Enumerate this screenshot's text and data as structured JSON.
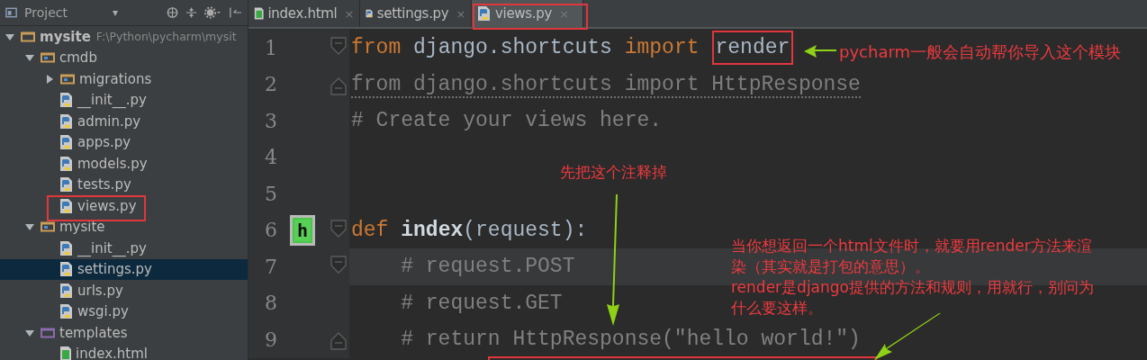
{
  "project_panel": {
    "title": "Project",
    "caret": "▾"
  },
  "tree": [
    {
      "label": "mysite",
      "path": "F:\\Python\\pycharm\\mysit",
      "kind": "project",
      "expanded": true,
      "selected": false,
      "children": [
        {
          "label": "cmdb",
          "kind": "module",
          "expanded": true,
          "selected": false,
          "children": [
            {
              "label": "migrations",
              "kind": "module",
              "expanded": false,
              "selected": false
            },
            {
              "label": "__init__.py",
              "kind": "py",
              "selected": false
            },
            {
              "label": "admin.py",
              "kind": "py",
              "selected": false
            },
            {
              "label": "apps.py",
              "kind": "py",
              "selected": false
            },
            {
              "label": "models.py",
              "kind": "py",
              "selected": false
            },
            {
              "label": "tests.py",
              "kind": "py",
              "selected": false
            },
            {
              "label": "views.py",
              "kind": "py",
              "selected": false
            }
          ]
        },
        {
          "label": "mysite",
          "kind": "module",
          "expanded": true,
          "selected": false,
          "children": [
            {
              "label": "__init__.py",
              "kind": "py",
              "selected": false
            },
            {
              "label": "settings.py",
              "kind": "py",
              "selected": true
            },
            {
              "label": "urls.py",
              "kind": "py",
              "selected": false
            },
            {
              "label": "wsgi.py",
              "kind": "py",
              "selected": false
            }
          ]
        },
        {
          "label": "templates",
          "kind": "templates",
          "expanded": true,
          "selected": false,
          "children": [
            {
              "label": "index.html",
              "kind": "html",
              "selected": false
            }
          ]
        }
      ]
    }
  ],
  "tabs": [
    {
      "label": "index.html",
      "kind": "html",
      "close": "×",
      "selected": false
    },
    {
      "label": "settings.py",
      "kind": "py",
      "close": "×",
      "selected": false
    },
    {
      "label": "views.py",
      "kind": "py",
      "close": "×",
      "selected": true
    }
  ],
  "code": [
    {
      "number": "1",
      "kind": "fold_start",
      "current": false,
      "tokens": [
        {
          "text": "from",
          "kind": "keyword"
        },
        {
          "text": " django.shortcuts ",
          "kind": "plain"
        },
        {
          "text": "import",
          "kind": "keyword"
        },
        {
          "text": "render",
          "kind": "boxed"
        }
      ]
    },
    {
      "number": "2",
      "kind": "fold_end",
      "current": false,
      "tokens": [
        {
          "text": "from django.shortcuts import HttpResponse",
          "kind": "unused"
        }
      ]
    },
    {
      "number": "3",
      "current": false,
      "tokens": [
        {
          "text": "# Create your views here.",
          "kind": "comment"
        }
      ]
    },
    {
      "number": "4",
      "current": false
    },
    {
      "number": "5",
      "current": false
    },
    {
      "number": "6",
      "kind": "fold_start",
      "marker": "h",
      "current": false,
      "tokens": [
        {
          "text": "def",
          "kind": "keyword"
        },
        {
          "text": " index",
          "kind": "func"
        },
        {
          "text": "(request):",
          "kind": "plain"
        }
      ]
    },
    {
      "number": "7",
      "kind": "fold_start",
      "current": true,
      "tokens": [
        {
          "text": "    # request.POST",
          "kind": "comment"
        }
      ]
    },
    {
      "number": "8",
      "current": false,
      "tokens": [
        {
          "text": "    # request.GET",
          "kind": "comment"
        }
      ]
    },
    {
      "number": "9",
      "kind": "fold_end",
      "current": false,
      "tokens": [
        {
          "text": "    # return HttpResponse(\"hello world!\")",
          "kind": "comment"
        }
      ]
    }
  ],
  "annotations": [
    {
      "kind": "top",
      "text": "pycharm一般会自动帮你导入这个模块"
    },
    {
      "kind": "middle",
      "text": "先把这个注释掉"
    },
    {
      "kind": "note",
      "text": "当你想返回一个html文件时，就要用render方法来渲染（其实就是打包的意思）。"
    },
    {
      "kind": "note",
      "text": "render是django提供的方法和规则，用就行，别问为什么要这样。"
    }
  ]
}
